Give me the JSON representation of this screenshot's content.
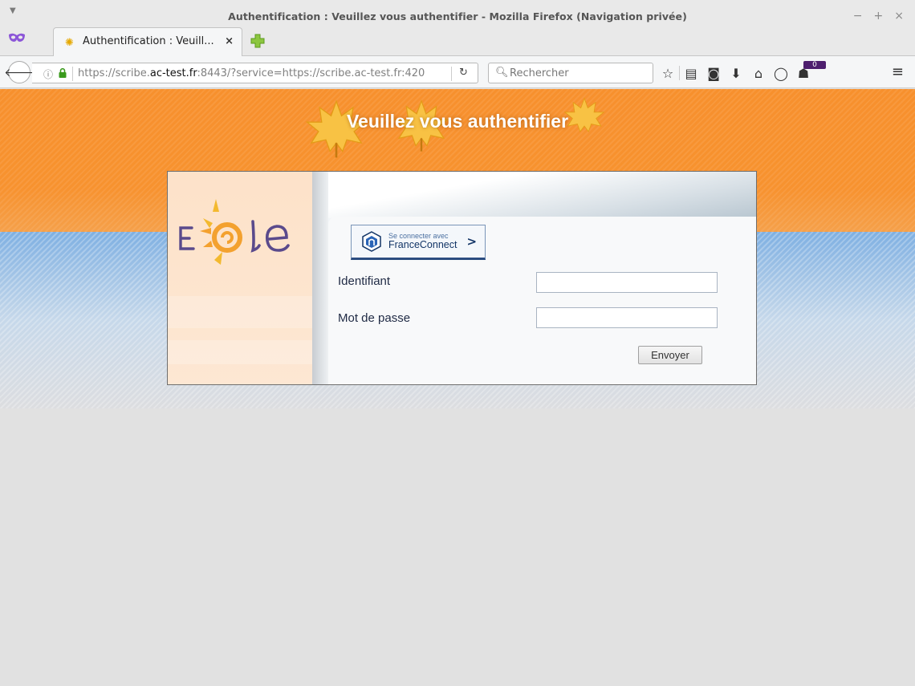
{
  "window": {
    "title": "Authentification : Veuillez vous authentifier - Mozilla Firefox (Navigation privée)",
    "controls": [
      "−",
      "+",
      "×"
    ]
  },
  "tab": {
    "label": "Authentification : Veuill...",
    "close": "×"
  },
  "nav": {
    "url_prefix": "https://scribe.",
    "url_domain": "ac-test.fr",
    "url_rest": ":8443/?service=https://scribe.ac-test.fr:420",
    "search_placeholder": "Rechercher",
    "notification_count": "0"
  },
  "page": {
    "heading": "Veuillez vous authentifier",
    "logo_text": "E le",
    "franceconnect": {
      "line1": "Se connecter avec",
      "line2": "FranceConnect",
      "chevron": ">"
    },
    "fields": [
      {
        "label": "Identifiant",
        "value": ""
      },
      {
        "label": "Mot de passe",
        "value": ""
      }
    ],
    "submit_label": "Envoyer"
  },
  "colors": {
    "orange_band": "#f7912f",
    "fc_navy": "#123466",
    "logo_purple": "#5a4a8c",
    "logo_orange": "#f3a12f",
    "private_purple": "#8c56d8"
  },
  "icons": [
    "dropdown-arrow-icon",
    "private-mask-icon",
    "favicon-icon",
    "new-tab-icon",
    "back-icon",
    "info-icon",
    "lock-icon",
    "reload-icon",
    "search-icon",
    "bookmark-star-icon",
    "reading-list-icon",
    "pocket-icon",
    "download-icon",
    "home-icon",
    "chat-icon",
    "notification-icon",
    "menu-icon"
  ]
}
